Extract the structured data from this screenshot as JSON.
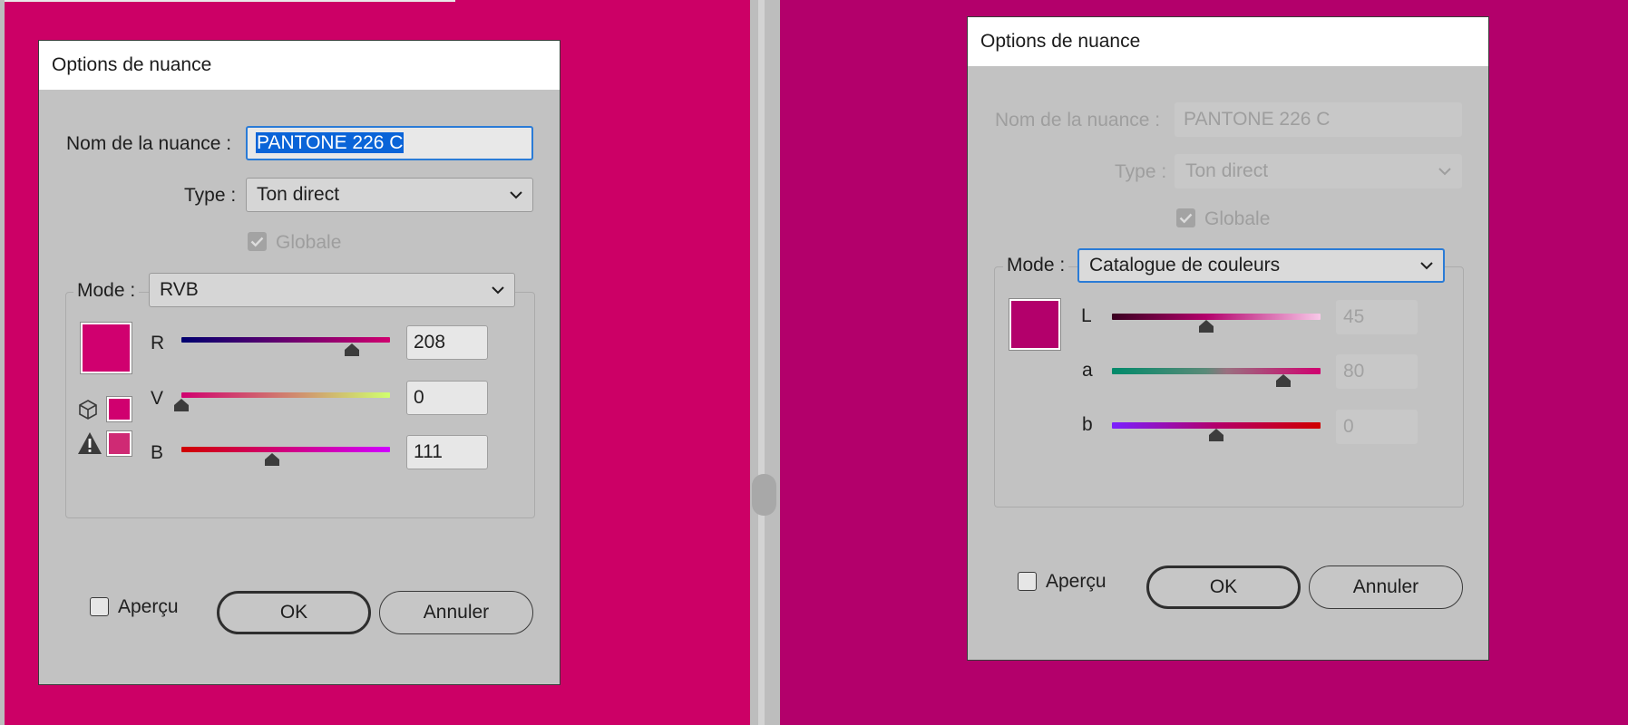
{
  "left_dialog": {
    "title": "Options de nuance",
    "name_label": "Nom de la nuance :",
    "name_value": "PANTONE 226 C",
    "type_label": "Type :",
    "type_value": "Ton direct",
    "global_label": "Globale",
    "global_checked": true,
    "mode_label": "Mode :",
    "mode_value": "RVB",
    "swatch_color": "#d0006f",
    "gamut_warning_color": "#cf2a74",
    "sliders": [
      {
        "label": "R",
        "value": "208",
        "level": 0.816
      },
      {
        "label": "V",
        "value": "0",
        "level": 0.0
      },
      {
        "label": "B",
        "value": "111",
        "level": 0.435
      }
    ],
    "preview_label": "Aperçu",
    "preview_checked": false,
    "ok_label": "OK",
    "cancel_label": "Annuler"
  },
  "right_dialog": {
    "title": "Options de nuance",
    "name_label": "Nom de la nuance :",
    "name_value": "PANTONE 226 C",
    "type_label": "Type :",
    "type_value": "Ton direct",
    "global_label": "Globale",
    "global_checked": true,
    "mode_label": "Mode :",
    "mode_value": "Catalogue de couleurs",
    "swatch_color": "#b3006b",
    "sliders": [
      {
        "label": "L",
        "value": "45",
        "level": 0.45
      },
      {
        "label": "a",
        "value": "80",
        "level": 0.82
      },
      {
        "label": "b",
        "value": "0",
        "level": 0.5
      }
    ],
    "preview_label": "Aperçu",
    "preview_checked": false,
    "ok_label": "OK",
    "cancel_label": "Annuler"
  },
  "colors": {
    "left_background": "#cc0066",
    "right_background": "#b3006b",
    "dialog_background": "#c2c2c2",
    "focus_ring": "#2a7bd6",
    "selection": "#0a64d8"
  },
  "icons": {
    "type_dropdown": "chevron-down-icon",
    "mode_dropdown": "chevron-down-icon",
    "out_of_web_gamut": "cube-icon",
    "out_of_gamut": "warning-triangle-icon",
    "global_check": "checkmark-icon",
    "slider_handle": "slider-thumb-icon"
  }
}
